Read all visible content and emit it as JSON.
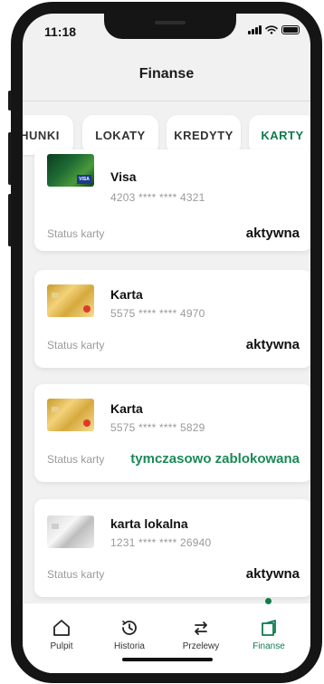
{
  "status_bar": {
    "time": "11:18"
  },
  "header": {
    "title": "Finanse"
  },
  "tabs": [
    {
      "label": "HUNKI",
      "active": false
    },
    {
      "label": "LOKATY",
      "active": false
    },
    {
      "label": "KREDYTY",
      "active": false
    },
    {
      "label": "KARTY",
      "active": true
    }
  ],
  "cards": [
    {
      "name": "Visa",
      "number": "4203 **** **** 4321",
      "status_label": "Status karty",
      "status": "aktywna",
      "thumb": "visa-card-image",
      "badge": "VISA"
    },
    {
      "name": "Karta",
      "number": "5575 **** **** 4970",
      "status_label": "Status karty",
      "status": "aktywna",
      "thumb": "gold-card-image"
    },
    {
      "name": "Karta",
      "number": "5575 **** **** 5829",
      "status_label": "Status karty",
      "status": "tymczasowo zablokowana",
      "thumb": "gold-card-image"
    },
    {
      "name": "karta lokalna",
      "number": "1231 **** **** 26940",
      "status_label": "Status karty",
      "status": "aktywna",
      "thumb": "silver-card-image"
    }
  ],
  "bottom_nav": [
    {
      "label": "Pulpit",
      "icon": "home-icon",
      "active": false
    },
    {
      "label": "Historia",
      "icon": "history-icon",
      "active": false
    },
    {
      "label": "Przelewy",
      "icon": "transfer-icon",
      "active": false
    },
    {
      "label": "Finanse",
      "icon": "finance-icon",
      "active": true
    }
  ],
  "colors": {
    "accent": "#0f7b4d",
    "blocked_status": "#1a8a57"
  }
}
